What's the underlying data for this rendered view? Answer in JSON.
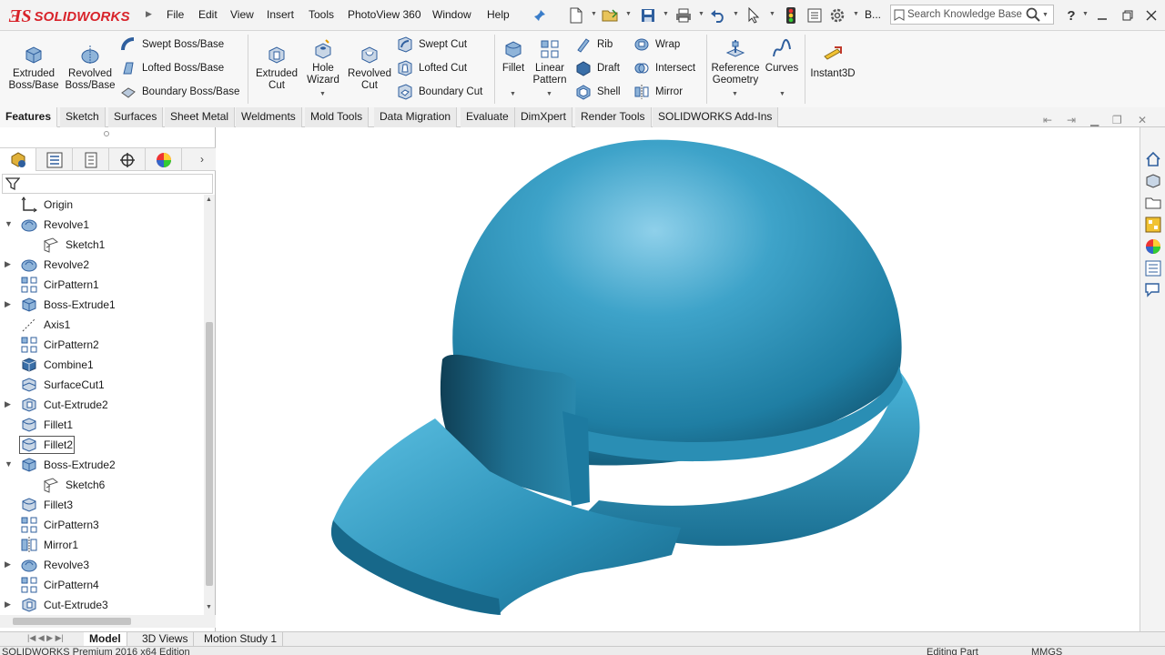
{
  "app": {
    "brand": "SOLIDWORKS",
    "menus": [
      "File",
      "Edit",
      "View",
      "Insert",
      "Tools",
      "PhotoView 360",
      "Window",
      "Help"
    ],
    "truncated_label": "B...",
    "search_placeholder": "Search Knowledge Base"
  },
  "ribbon": {
    "extruded_boss": "Extruded Boss/Base",
    "revolved_boss": "Revolved Boss/Base",
    "swept_boss": "Swept Boss/Base",
    "lofted_boss": "Lofted Boss/Base",
    "boundary_boss": "Boundary Boss/Base",
    "extruded_cut": "Extruded Cut",
    "hole_wizard": "Hole Wizard",
    "revolved_cut": "Revolved Cut",
    "swept_cut": "Swept Cut",
    "lofted_cut": "Lofted Cut",
    "boundary_cut": "Boundary Cut",
    "fillet": "Fillet",
    "linear_pattern": "Linear Pattern",
    "rib": "Rib",
    "draft": "Draft",
    "shell": "Shell",
    "wrap": "Wrap",
    "intersect": "Intersect",
    "mirror": "Mirror",
    "reference_geometry": "Reference Geometry",
    "curves": "Curves",
    "instant3d": "Instant3D"
  },
  "tabs": [
    "Features",
    "Sketch",
    "Surfaces",
    "Sheet Metal",
    "Weldments",
    "Mold Tools",
    "Data Migration",
    "Evaluate",
    "DimXpert",
    "Render Tools",
    "SOLIDWORKS Add-Ins"
  ],
  "active_tab": "Features",
  "tree": [
    {
      "label": "Origin",
      "icon": "origin-icon",
      "indent": 0,
      "expander": ""
    },
    {
      "label": "Revolve1",
      "icon": "revolve-icon",
      "indent": 0,
      "expander": "open"
    },
    {
      "label": "Sketch1",
      "icon": "sketch-icon",
      "indent": 1,
      "expander": ""
    },
    {
      "label": "Revolve2",
      "icon": "revolve-icon",
      "indent": 0,
      "expander": "closed"
    },
    {
      "label": "CirPattern1",
      "icon": "circular-pattern-icon",
      "indent": 0,
      "expander": ""
    },
    {
      "label": "Boss-Extrude1",
      "icon": "extrude-icon",
      "indent": 0,
      "expander": "closed"
    },
    {
      "label": "Axis1",
      "icon": "axis-icon",
      "indent": 0,
      "expander": ""
    },
    {
      "label": "CirPattern2",
      "icon": "circular-pattern-icon",
      "indent": 0,
      "expander": ""
    },
    {
      "label": "Combine1",
      "icon": "combine-icon",
      "indent": 0,
      "expander": ""
    },
    {
      "label": "SurfaceCut1",
      "icon": "surface-cut-icon",
      "indent": 0,
      "expander": ""
    },
    {
      "label": "Cut-Extrude2",
      "icon": "cut-extrude-icon",
      "indent": 0,
      "expander": "closed"
    },
    {
      "label": "Fillet1",
      "icon": "fillet-icon",
      "indent": 0,
      "expander": ""
    },
    {
      "label": "Fillet2",
      "icon": "fillet-icon",
      "indent": 0,
      "expander": "",
      "selected": true
    },
    {
      "label": "Boss-Extrude2",
      "icon": "extrude-icon",
      "indent": 0,
      "expander": "open"
    },
    {
      "label": "Sketch6",
      "icon": "sketch-icon",
      "indent": 1,
      "expander": ""
    },
    {
      "label": "Fillet3",
      "icon": "fillet-icon",
      "indent": 0,
      "expander": ""
    },
    {
      "label": "CirPattern3",
      "icon": "circular-pattern-icon",
      "indent": 0,
      "expander": ""
    },
    {
      "label": "Mirror1",
      "icon": "mirror-icon",
      "indent": 0,
      "expander": ""
    },
    {
      "label": "Revolve3",
      "icon": "revolve-icon",
      "indent": 0,
      "expander": "closed"
    },
    {
      "label": "CirPattern4",
      "icon": "circular-pattern-icon",
      "indent": 0,
      "expander": ""
    },
    {
      "label": "Cut-Extrude3",
      "icon": "cut-extrude-icon",
      "indent": 0,
      "expander": "closed"
    }
  ],
  "bottom_tabs": [
    "Model",
    "3D Views",
    "Motion Study 1"
  ],
  "active_bottom_tab": "Model",
  "status": {
    "left": "SOLIDWORKS Premium 2016 x64 Edition",
    "mode": "Editing Part",
    "units": "MMGS"
  },
  "colors": {
    "model": "#2e8fb3",
    "brand_red": "#d8232a",
    "icon_blue": "#3a6fa8"
  }
}
